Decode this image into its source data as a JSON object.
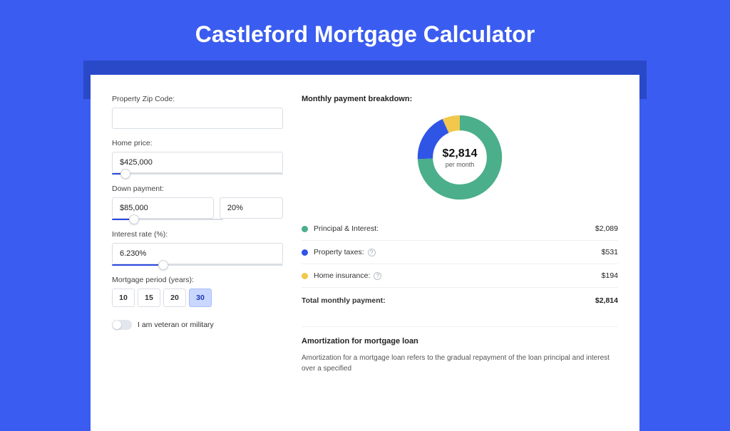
{
  "title": "Castleford Mortgage Calculator",
  "form": {
    "zip_label": "Property Zip Code:",
    "zip_value": "",
    "home_price_label": "Home price:",
    "home_price_value": "$425,000",
    "home_price_slider_pct": 8,
    "down_payment_label": "Down payment:",
    "down_payment_value": "$85,000",
    "down_payment_pct": "20%",
    "down_payment_slider_pct": 20,
    "interest_label": "Interest rate (%):",
    "interest_value": "6.230%",
    "interest_slider_pct": 30,
    "period_label": "Mortgage period (years):",
    "periods": [
      "10",
      "15",
      "20",
      "30"
    ],
    "period_selected": "30",
    "veteran_label": "I am veteran or military"
  },
  "breakdown": {
    "title": "Monthly payment breakdown:",
    "amount": "$2,814",
    "per_month": "per month",
    "items": [
      {
        "label": "Principal & Interest:",
        "amount": "$2,089",
        "color": "green",
        "help": false
      },
      {
        "label": "Property taxes:",
        "amount": "$531",
        "color": "blue",
        "help": true
      },
      {
        "label": "Home insurance:",
        "amount": "$194",
        "color": "yellow",
        "help": true
      }
    ],
    "total_label": "Total monthly payment:",
    "total_amount": "$2,814"
  },
  "amortization": {
    "title": "Amortization for mortgage loan",
    "text": "Amortization for a mortgage loan refers to the gradual repayment of the loan principal and interest over a specified"
  },
  "chart_data": {
    "type": "pie",
    "title": "Monthly payment breakdown",
    "series": [
      {
        "name": "Principal & Interest",
        "value": 2089,
        "color": "#4aaf8a"
      },
      {
        "name": "Property taxes",
        "value": 531,
        "color": "#2f55e6"
      },
      {
        "name": "Home insurance",
        "value": 194,
        "color": "#f1c84c"
      }
    ],
    "total": 2814,
    "center_label": "$2,814 per month"
  }
}
